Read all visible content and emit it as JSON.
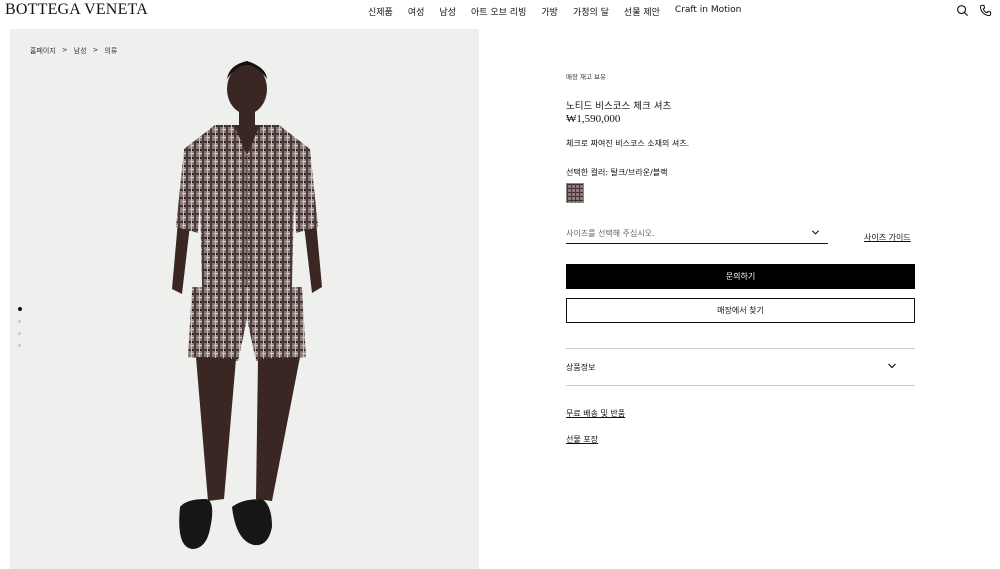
{
  "header": {
    "logo": "BOTTEGA VENETA",
    "nav": [
      "신제품",
      "여성",
      "남성",
      "아트 오브 리빙",
      "가방",
      "가정의 달",
      "선물 제안",
      "Craft in Motion"
    ],
    "icons": [
      "search-icon",
      "phone-icon"
    ]
  },
  "breadcrumb": {
    "items": [
      "홈페이지",
      "남성",
      "의류"
    ],
    "separator": ">"
  },
  "gallery": {
    "slide_count": 4,
    "active_slide": 1,
    "bg_color": "#eff0ee"
  },
  "product": {
    "stock_status": "매장 재고 보유",
    "name": "노티드 비스코스 체크 셔츠",
    "price": "₩1,590,000",
    "description": "체크로 짜여진 비스코스 소재의 셔츠.",
    "selected_color_label": "선택한 컬러: 탈크/브라운/블랙",
    "size_placeholder": "사이즈를 선택해 주십시오.",
    "size_guide": "사이즈 가이드",
    "primary_button": "문의하기",
    "secondary_button": "매장에서 찾기",
    "accordion_label": "상품정보",
    "links": [
      "무료 배송 및 반품",
      "선물 포장"
    ]
  }
}
